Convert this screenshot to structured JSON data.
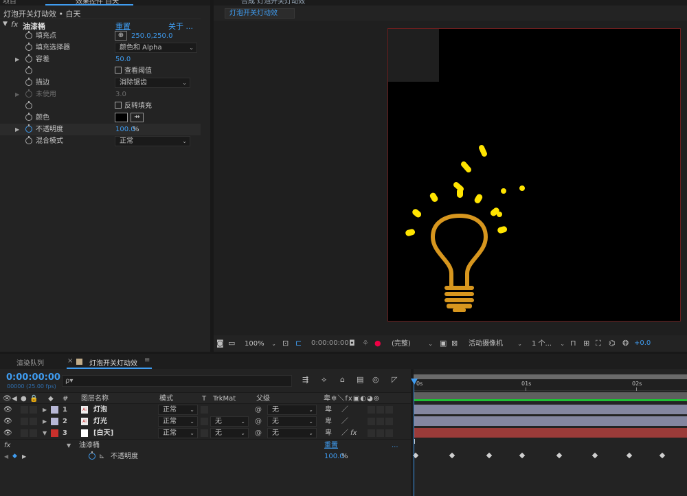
{
  "effect_panel": {
    "top_tab_1": "项目",
    "top_tab_2": "效果控件 白天",
    "title": "灯泡开关灯动效 • 白天",
    "fx_label": "fx",
    "effect_name": "油漆桶",
    "reset": "重置",
    "about": "关于 ...",
    "props": [
      {
        "label": "填充点",
        "value": "250.0,250.0"
      },
      {
        "label": "填充选择器",
        "value": "颜色和 Alpha"
      },
      {
        "label": "容差",
        "value": "50.0"
      },
      {
        "label": "",
        "value": "查看阈值"
      },
      {
        "label": "描边",
        "value": "消除锯齿"
      },
      {
        "label": "未使用",
        "value": "3.0"
      },
      {
        "label": "",
        "value": "反转填充"
      },
      {
        "label": "颜色",
        "value": ""
      },
      {
        "label": "不透明度",
        "value": "100.0",
        "unit": "%"
      },
      {
        "label": "混合模式",
        "value": "正常"
      }
    ]
  },
  "comp_viewer": {
    "header_text": "合成 灯泡开关灯动效",
    "comp_tab": "灯泡开关灯动效",
    "zoom": "100%",
    "timecode": "0:00:00:00",
    "resolution": "(完整)",
    "camera": "活动摄像机",
    "views": "1 个...",
    "exposure": "+0.0",
    "bulb_color": "#d7961e",
    "rays_color": "#ffe400"
  },
  "timeline": {
    "render_queue_tab": "渲染队列",
    "comp_tab": "灯泡开关灯动效",
    "timecode": "0:00:00:00",
    "fps": "00000 (25.00 fps)",
    "search_placeholder": "ρ▾",
    "col_hash": "#",
    "col_layer_name": "图层名称",
    "col_mode": "模式",
    "col_t": "T",
    "col_trkmat": "TrkMat",
    "col_parent": "父级",
    "ruler": [
      "0s",
      "01s",
      "02s"
    ],
    "layers": [
      {
        "num": "1",
        "name": "灯泡",
        "mode": "正常",
        "trkmat": "",
        "parent": "无",
        "color": "#b7b7d6"
      },
      {
        "num": "2",
        "name": "灯光",
        "mode": "正常",
        "trkmat": "无",
        "parent": "无",
        "color": "#b7b7d6"
      },
      {
        "num": "3",
        "name": "[白天]",
        "mode": "正常",
        "trkmat": "无",
        "parent": "无",
        "color": "#c8302c"
      }
    ],
    "effect_row": {
      "fx": "fx",
      "name": "油漆桶",
      "reset": "重置",
      "more": "..."
    },
    "opacity_row": {
      "name": "不透明度",
      "value": "100.0",
      "unit": "%"
    }
  }
}
